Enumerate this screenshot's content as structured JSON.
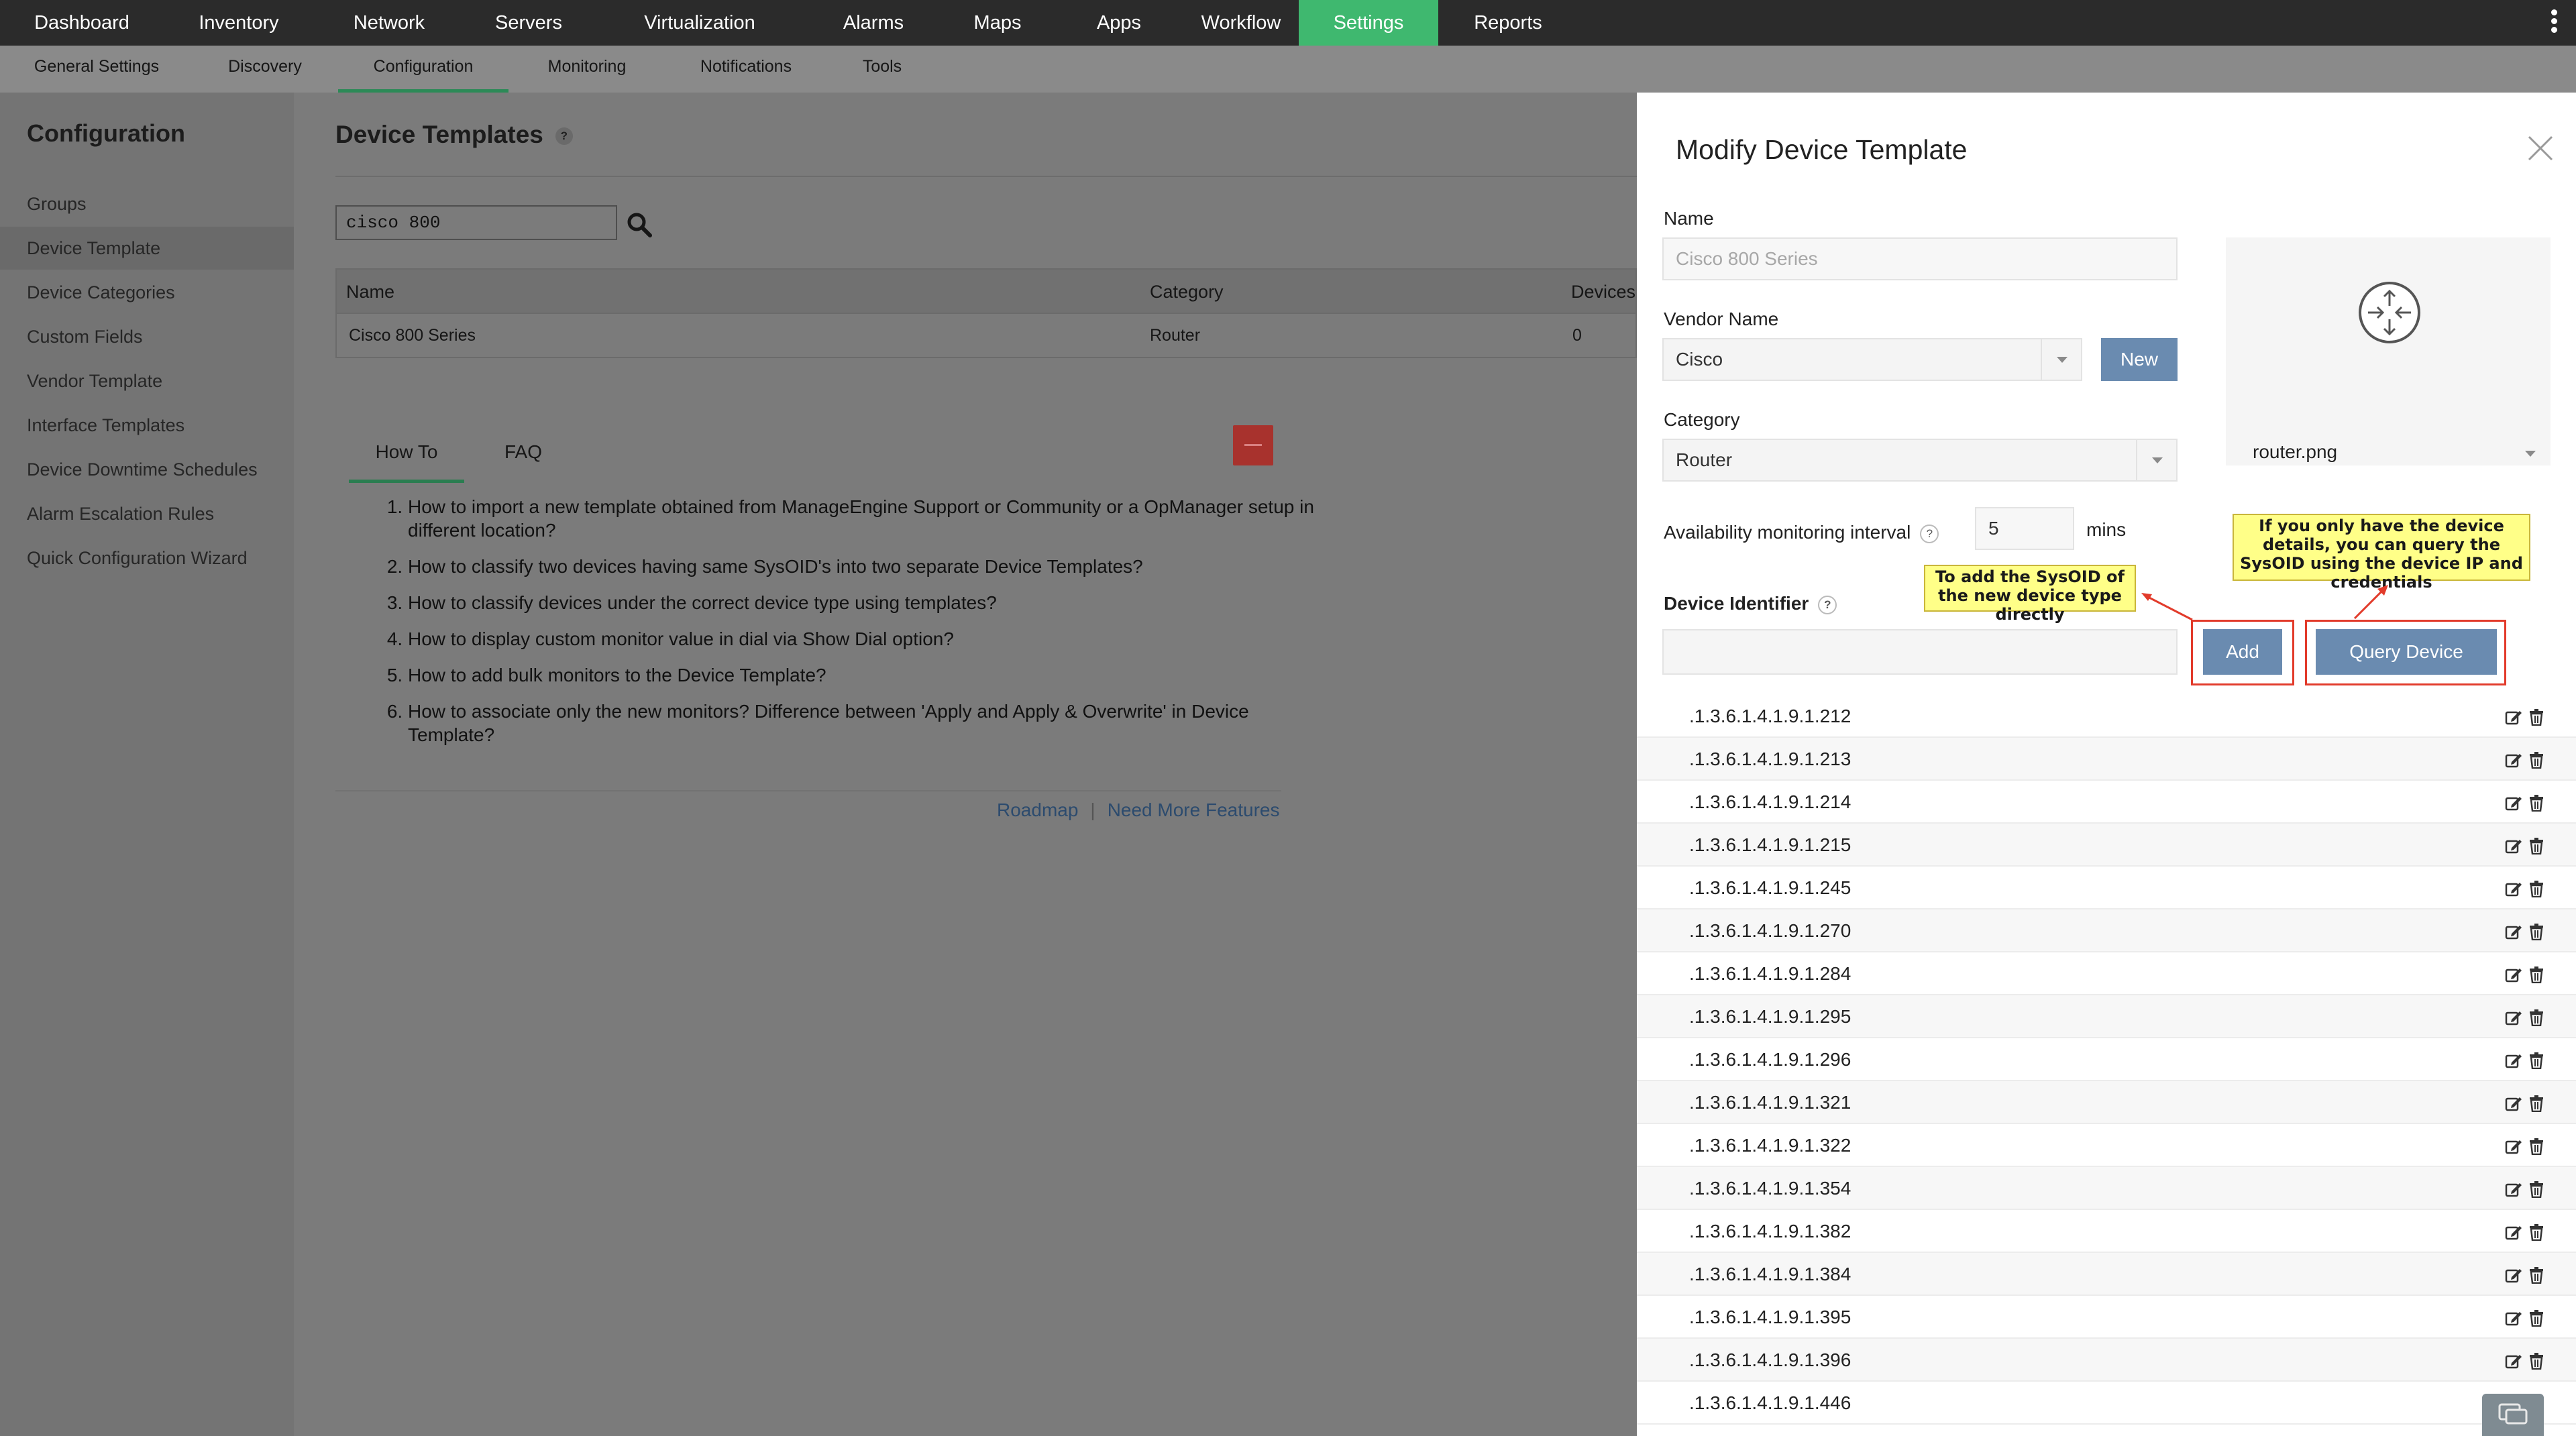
{
  "topnav": {
    "items": [
      "Dashboard",
      "Inventory",
      "Network",
      "Servers",
      "Virtualization",
      "Alarms",
      "Maps",
      "Apps",
      "Workflow",
      "Settings",
      "Reports"
    ],
    "active": "Settings",
    "active_color": "#3fb86f"
  },
  "subnav": {
    "items": [
      "General Settings",
      "Discovery",
      "Configuration",
      "Monitoring",
      "Notifications",
      "Tools"
    ],
    "active": "Configuration"
  },
  "sidebar": {
    "title": "Configuration",
    "items": [
      "Groups",
      "Device Template",
      "Device Categories",
      "Custom Fields",
      "Vendor Template",
      "Interface Templates",
      "Device Downtime Schedules",
      "Alarm Escalation Rules",
      "Quick Configuration Wizard"
    ],
    "active": "Device Template"
  },
  "main": {
    "title": "Device Templates",
    "help": "?",
    "search_value": "cisco 800",
    "table": {
      "headers": [
        "Name",
        "Category",
        "Devices"
      ],
      "rows": [
        [
          "Cisco 800 Series",
          "Router",
          "0"
        ]
      ]
    },
    "tabs": [
      "How To",
      "FAQ"
    ],
    "faq": [
      "How to import a new template obtained from ManageEngine Support or Community or a OpManager setup in different location?",
      "How to classify two devices having same SysOID's into two separate Device Templates?",
      "How to classify devices under the correct device type using templates?",
      "How to display custom monitor value in dial via Show Dial option?",
      "How to add bulk monitors to the Device Template?",
      "How to associate only the new monitors? Difference between 'Apply and Apply & Overwrite' in Device Template?"
    ],
    "links": [
      "Roadmap",
      "Need More Features"
    ],
    "link_separator": "|"
  },
  "panel": {
    "title": "Modify Device Template",
    "name_label": "Name",
    "name_placeholder": "Cisco 800 Series",
    "vendor_label": "Vendor Name",
    "vendor_value": "Cisco",
    "new_button": "New",
    "category_label": "Category",
    "category_value": "Router",
    "interval_label": "Availability monitoring interval",
    "interval_value": "5",
    "interval_unit": "mins",
    "device_identifier_label": "Device Identifier",
    "help": "?",
    "icon_file": "router.png",
    "add_button": "Add",
    "query_button": "Query Device",
    "callout_add": "To add the SysOID of the new device type directly",
    "callout_query": "If you only have the device details, you can query the SysOID using the device IP and credentials",
    "button_color": "#6a8bb0",
    "callout_color": "#ffff88",
    "highlight_color": "#e23b2b",
    "oids": [
      ".1.3.6.1.4.1.9.1.212",
      ".1.3.6.1.4.1.9.1.213",
      ".1.3.6.1.4.1.9.1.214",
      ".1.3.6.1.4.1.9.1.215",
      ".1.3.6.1.4.1.9.1.245",
      ".1.3.6.1.4.1.9.1.270",
      ".1.3.6.1.4.1.9.1.284",
      ".1.3.6.1.4.1.9.1.295",
      ".1.3.6.1.4.1.9.1.296",
      ".1.3.6.1.4.1.9.1.321",
      ".1.3.6.1.4.1.9.1.322",
      ".1.3.6.1.4.1.9.1.354",
      ".1.3.6.1.4.1.9.1.382",
      ".1.3.6.1.4.1.9.1.384",
      ".1.3.6.1.4.1.9.1.395",
      ".1.3.6.1.4.1.9.1.396",
      ".1.3.6.1.4.1.9.1.446"
    ]
  },
  "icons": [
    "kebab-menu-icon",
    "search-icon",
    "close-icon",
    "router-icon",
    "edit-icon",
    "trash-icon",
    "chat-icon",
    "collapse-icon"
  ]
}
